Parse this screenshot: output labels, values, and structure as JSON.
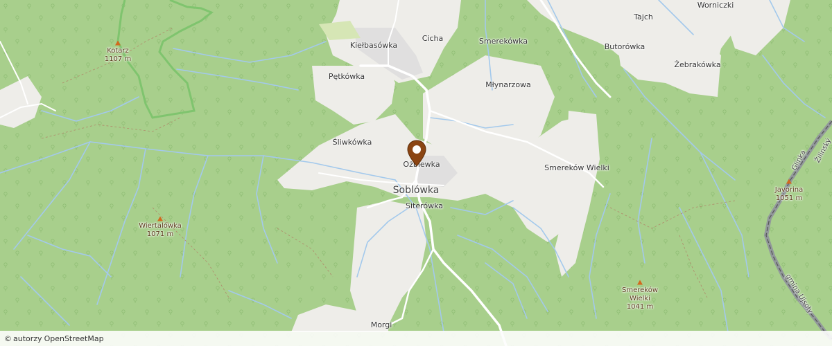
{
  "map": {
    "center_label": "Soblówka",
    "places": [
      {
        "id": "kielbasowka",
        "name": "Kiełbasówka"
      },
      {
        "id": "cicha",
        "name": "Cicha"
      },
      {
        "id": "smerekowka",
        "name": "Smereków­ka"
      },
      {
        "id": "tajch",
        "name": "Tajch"
      },
      {
        "id": "worniczki",
        "name": "Worniczki"
      },
      {
        "id": "butorowka",
        "name": "Butorówka"
      },
      {
        "id": "zebrakowka",
        "name": "Żebrakówka"
      },
      {
        "id": "petkowka",
        "name": "Pętkówka"
      },
      {
        "id": "mlynarzowa",
        "name": "Młynarzowa"
      },
      {
        "id": "sliwkowka",
        "name": "Śliwkówka"
      },
      {
        "id": "ozbiewka",
        "name": "Ożbiewka"
      },
      {
        "id": "smerekow-wielki-place",
        "name": "Smereków Wielki"
      },
      {
        "id": "siterowka",
        "name": "Siterówka"
      },
      {
        "id": "morgi",
        "name": "Morgi"
      }
    ],
    "peaks": [
      {
        "id": "kotarz",
        "name": "Kotarz",
        "elevation": "1107 m"
      },
      {
        "id": "wiertalowka",
        "name": "Wiertalówka",
        "elevation": "1071 m"
      },
      {
        "id": "javorina",
        "name": "Javorina",
        "elevation": "1051 m"
      },
      {
        "id": "smerekow-wielki-peak",
        "name": "Smereków Wielki",
        "elevation": "1041 m"
      }
    ],
    "border_labels": {
      "glinka": "Glinka",
      "zilinsky": "Žilinský",
      "gmina": "gmina Ujsoły"
    },
    "colors": {
      "forest": "#a8cf8c",
      "open_land": "#eeede9",
      "stream": "#a3c9ec",
      "road": "#ffffff",
      "marker": "#8b4513",
      "border": "#8e8e9e",
      "park_boundary": "#7fc46e"
    }
  },
  "attribution": {
    "copyright": "©",
    "authors_text": "autorzy",
    "source_link": "OpenStreetMap"
  }
}
